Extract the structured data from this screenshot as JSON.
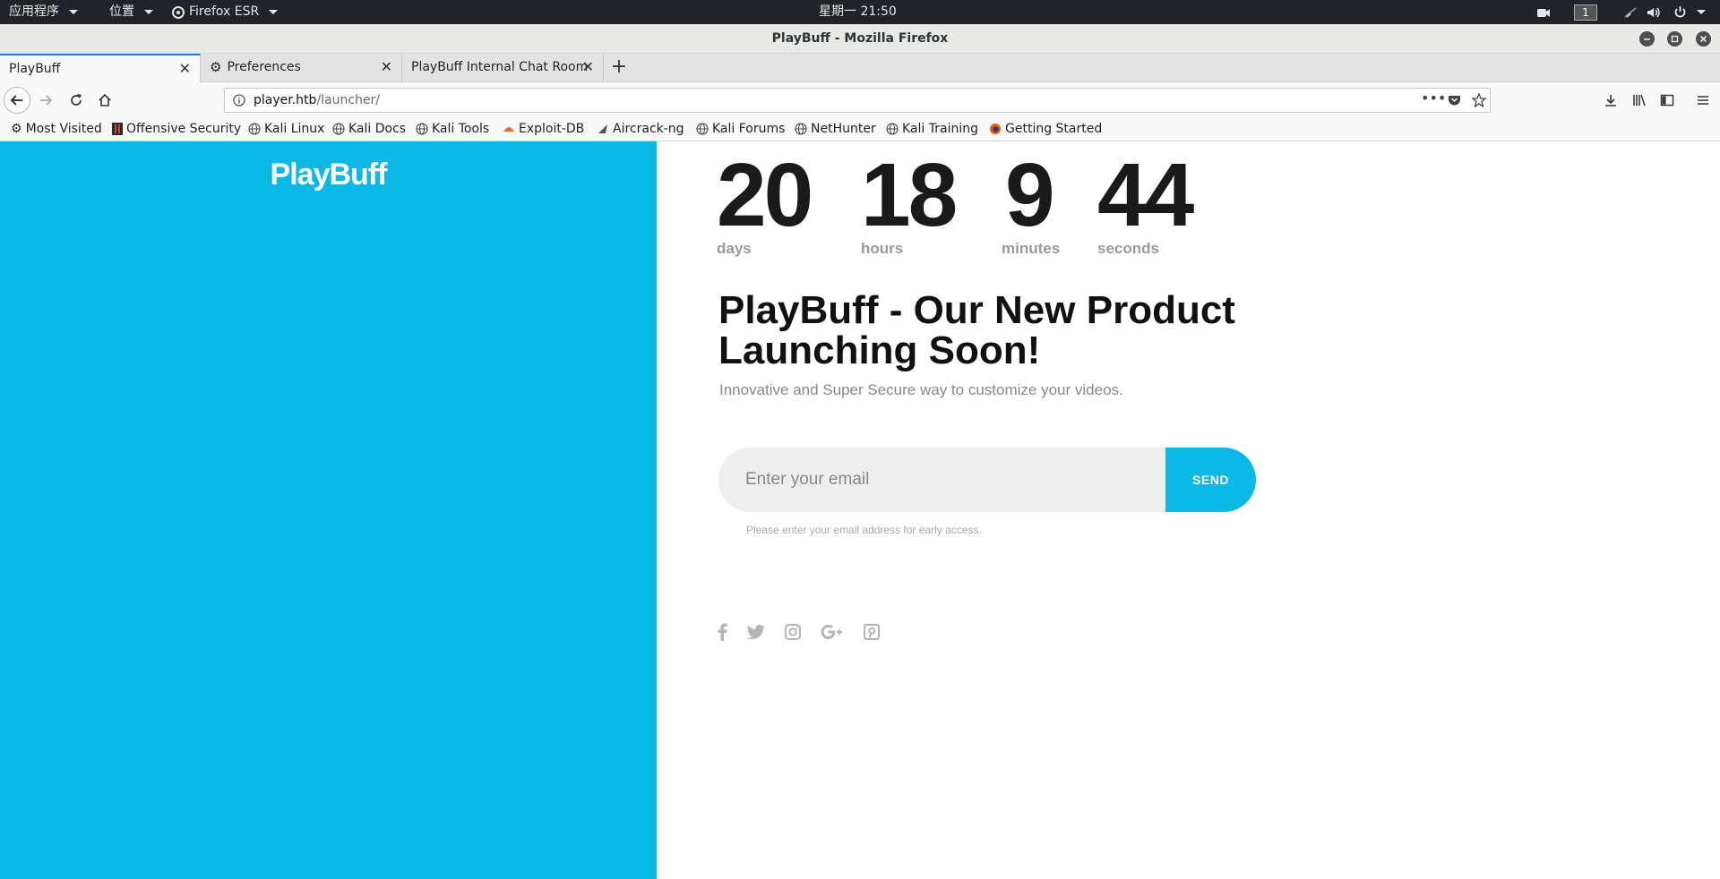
{
  "system_bar": {
    "apps_menu": "应用程序",
    "places_menu": "位置",
    "active_app": "Firefox ESR",
    "clock": "星期一 21:50",
    "workspace": "1"
  },
  "window": {
    "title": "PlayBuff - Mozilla Firefox"
  },
  "tabs": [
    {
      "label": "PlayBuff",
      "active": true
    },
    {
      "label": "Preferences",
      "active": false
    },
    {
      "label": "PlayBuff Internal Chat Room",
      "active": false
    }
  ],
  "navigation": {
    "url_host": "player.htb",
    "url_path": "/launcher/"
  },
  "bookmarks": [
    {
      "label": "Most Visited",
      "icon": "gear-icon"
    },
    {
      "label": "Offensive Security",
      "icon": "offsec-icon"
    },
    {
      "label": "Kali Linux",
      "icon": "globe-icon"
    },
    {
      "label": "Kali Docs",
      "icon": "globe-icon"
    },
    {
      "label": "Kali Tools",
      "icon": "globe-icon"
    },
    {
      "label": "Exploit-DB",
      "icon": "exploitdb-icon"
    },
    {
      "label": "Aircrack-ng",
      "icon": "aircrack-icon"
    },
    {
      "label": "Kali Forums",
      "icon": "globe-icon"
    },
    {
      "label": "NetHunter",
      "icon": "globe-icon"
    },
    {
      "label": "Kali Training",
      "icon": "globe-icon"
    },
    {
      "label": "Getting Started",
      "icon": "firefox-icon"
    }
  ],
  "page": {
    "brand": "PlayBuff",
    "countdown": {
      "days": {
        "value": "20",
        "label": "days"
      },
      "hours": {
        "value": "18",
        "label": "hours"
      },
      "minutes": {
        "value": "9",
        "label": "minutes"
      },
      "seconds": {
        "value": "44",
        "label": "seconds"
      }
    },
    "headline": "PlayBuff - Our New Product Launching Soon!",
    "subtext": "Innovative and Super Secure way to customize your videos.",
    "email_placeholder": "Enter your email",
    "send_label": "SEND",
    "help_text": "Please enter your email address for early access.",
    "socials": [
      "facebook-icon",
      "twitter-icon",
      "instagram-icon",
      "google-plus-icon",
      "pinterest-icon"
    ],
    "accent_color": "#0cb9e6"
  }
}
